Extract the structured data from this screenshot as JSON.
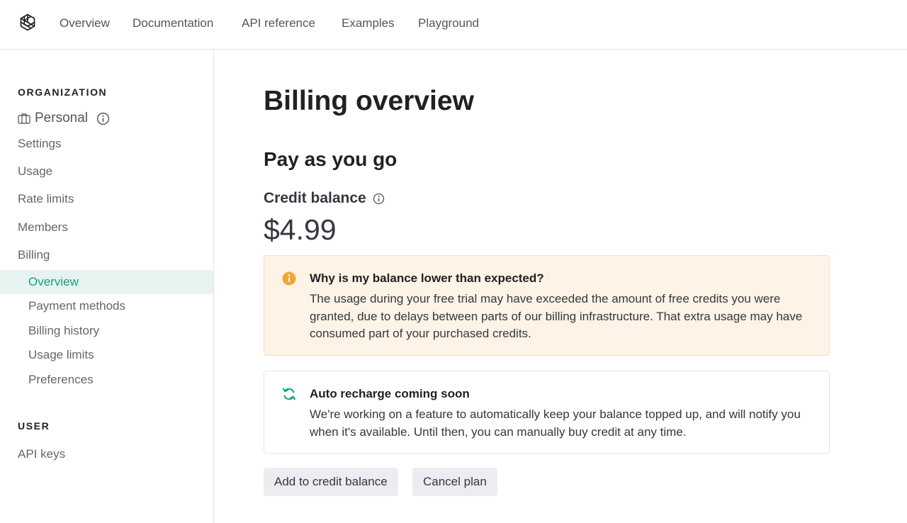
{
  "topnav": {
    "logo": "openai-logo-icon",
    "links": [
      "Overview",
      "Documentation",
      "API reference",
      "Examples",
      "Playground"
    ]
  },
  "sidebar": {
    "organization_label": "ORGANIZATION",
    "org_name": "Personal",
    "org_icon": "briefcase-icon",
    "org_info_icon": "info-icon",
    "items": [
      "Settings",
      "Usage",
      "Rate limits",
      "Members",
      "Billing"
    ],
    "billing_subitems": [
      {
        "label": "Overview",
        "active": true
      },
      {
        "label": "Payment methods",
        "active": false
      },
      {
        "label": "Billing history",
        "active": false
      },
      {
        "label": "Usage limits",
        "active": false
      },
      {
        "label": "Preferences",
        "active": false
      }
    ],
    "user_label": "USER",
    "user_items": [
      "API keys"
    ]
  },
  "main": {
    "title": "Billing overview",
    "plan_title": "Pay as you go",
    "credit_label": "Credit balance",
    "credit_amount": "$4.99",
    "warning": {
      "icon": "info-circle-icon",
      "title": "Why is my balance lower than expected?",
      "body": "The usage during your free trial may have exceeded the amount of free credits you were granted, due to delays between parts of our billing infrastructure. That extra usage may have consumed part of your purchased credits."
    },
    "notice": {
      "icon": "refresh-icon",
      "title": "Auto recharge coming soon",
      "body": "We're working on a feature to automatically keep your balance topped up, and will notify you when it's available. Until then, you can manually buy credit at any time."
    },
    "buttons": {
      "add_credit": "Add to credit balance",
      "cancel_plan": "Cancel plan"
    }
  },
  "colors": {
    "accent": "#10a37f",
    "active_bg": "#e6f3f0",
    "warning_bg": "#fdf3e6",
    "warning_icon": "#f0a73a",
    "button_bg": "#ececf1"
  }
}
